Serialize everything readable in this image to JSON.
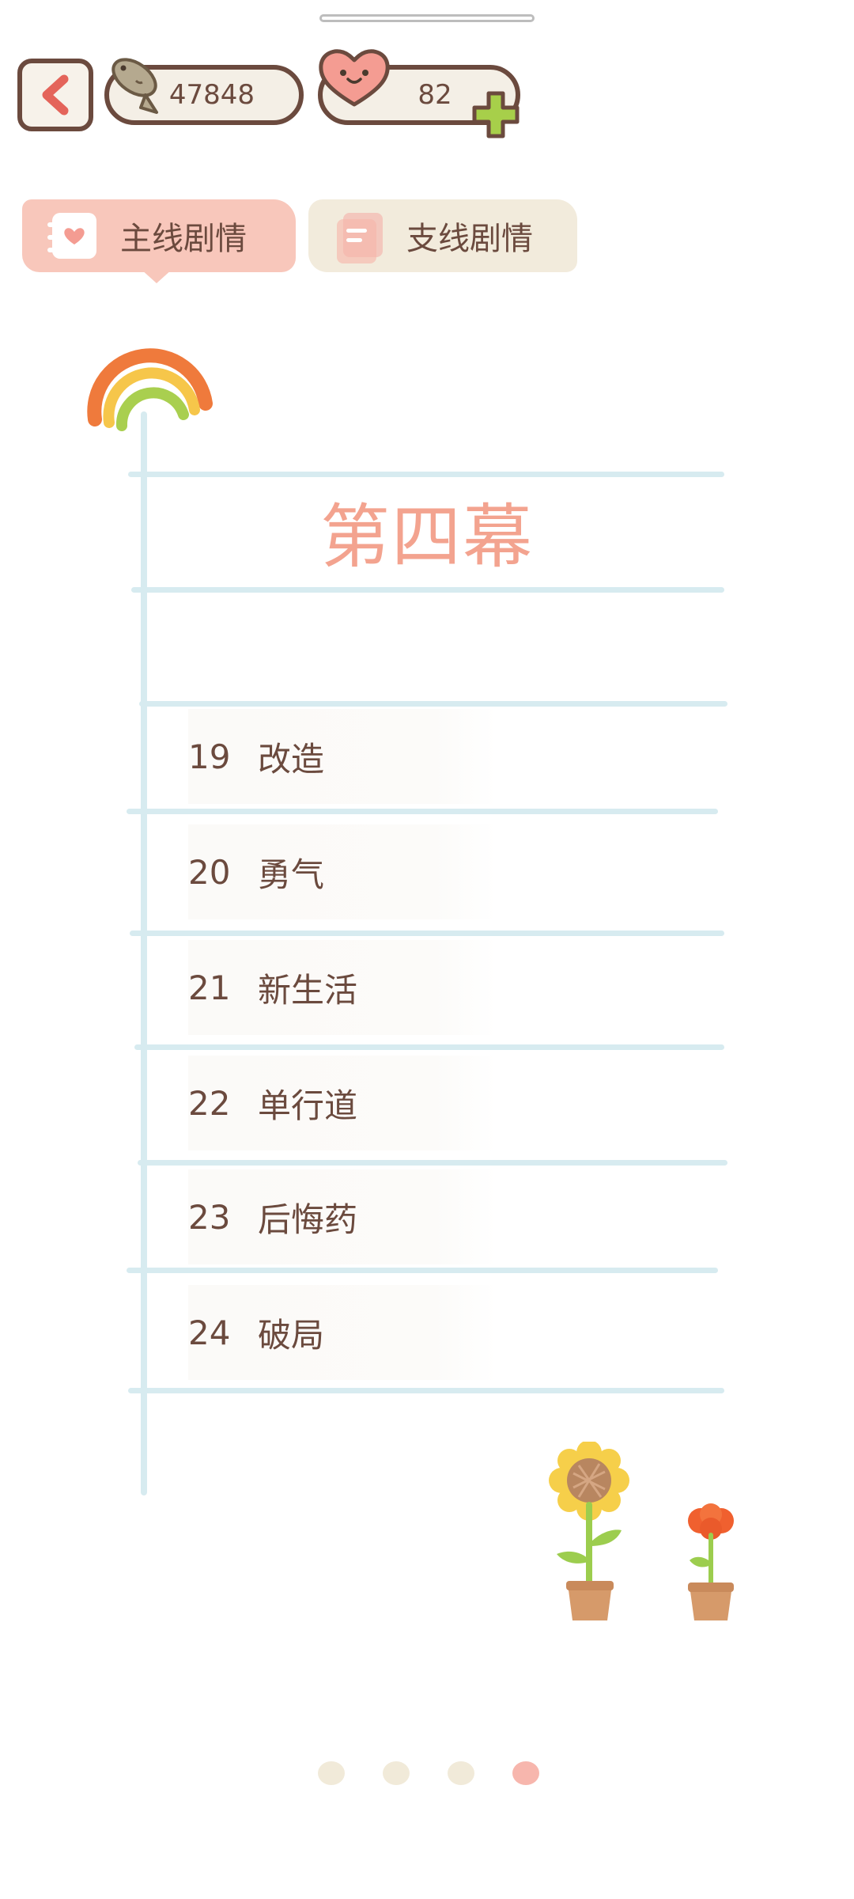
{
  "header": {
    "back_icon": "chevron-left-icon",
    "fish": {
      "icon": "fish-icon",
      "value": "47848"
    },
    "heart": {
      "icon": "heart-face-icon",
      "value": "82",
      "add_icon": "plus-icon"
    }
  },
  "tabs": [
    {
      "label": "主线剧情",
      "icon": "heart-notebook-icon",
      "active": true
    },
    {
      "label": "支线剧情",
      "icon": "notebook-icon",
      "active": false
    }
  ],
  "act": {
    "title": "第四幕"
  },
  "chapters": [
    {
      "number": "19",
      "title": "改造"
    },
    {
      "number": "20",
      "title": "勇气"
    },
    {
      "number": "21",
      "title": "新生活"
    },
    {
      "number": "22",
      "title": "单行道"
    },
    {
      "number": "23",
      "title": "后悔药"
    },
    {
      "number": "24",
      "title": "破局"
    }
  ],
  "pagination": {
    "total": 4,
    "current": 4
  },
  "colors": {
    "accent": "#f3a38f",
    "text": "#6b4a3e",
    "line": "#d7ebf0",
    "dot_inactive": "#f1ead9",
    "dot_active": "#f7b6ad"
  }
}
